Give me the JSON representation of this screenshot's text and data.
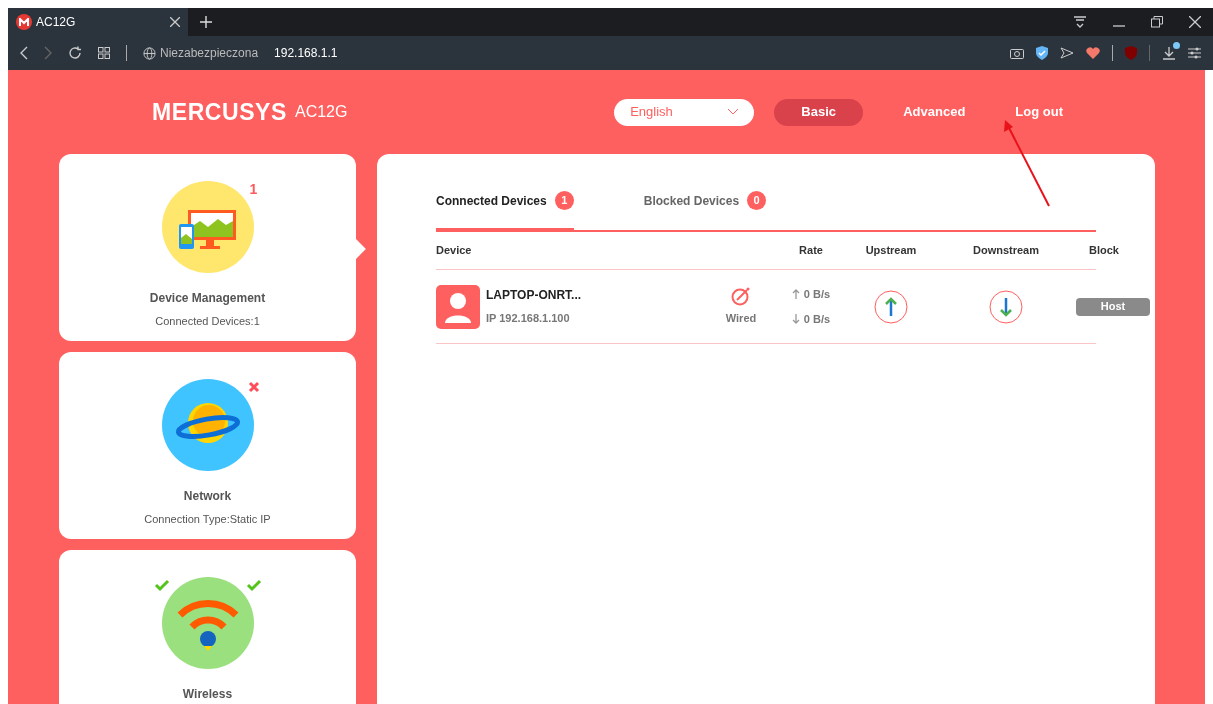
{
  "browser": {
    "tab_title": "AC12G",
    "security": "Niezabezpieczona",
    "url": "192.168.1.1"
  },
  "header": {
    "logo": "MERCUSYS",
    "model": "AC12G",
    "language": "English",
    "nav": [
      {
        "label": "Basic",
        "selected": true
      },
      {
        "label": "Advanced",
        "selected": false
      },
      {
        "label": "Log out",
        "selected": false
      }
    ]
  },
  "cards": [
    {
      "kind": "devices",
      "title": "Device Management",
      "subtitle": "Connected Devices:1",
      "selected": true,
      "badges": [
        {
          "kind": "count",
          "text": "1"
        }
      ]
    },
    {
      "kind": "planet",
      "title": "Network",
      "subtitle": "Connection Type:Static IP",
      "selected": false,
      "badges": [
        {
          "kind": "error"
        }
      ]
    },
    {
      "kind": "wifi",
      "title": "Wireless",
      "selected": false,
      "badges": [
        {
          "kind": "ok"
        },
        {
          "kind": "ok"
        }
      ]
    }
  ],
  "tabs": [
    {
      "label": "Connected Devices",
      "count": "1",
      "selected": true
    },
    {
      "label": "Blocked Devices",
      "count": "0",
      "selected": false
    }
  ],
  "table": {
    "columns": [
      "Device",
      "Rate",
      "Upstream",
      "Downstream",
      "Block"
    ],
    "rows": [
      {
        "name": "LAPTOP-ONRT...",
        "ip": "IP 192.168.1.100",
        "connection": "Wired",
        "up_rate": "0 B/s",
        "down_rate": "0 B/s",
        "block": "Host"
      }
    ]
  }
}
